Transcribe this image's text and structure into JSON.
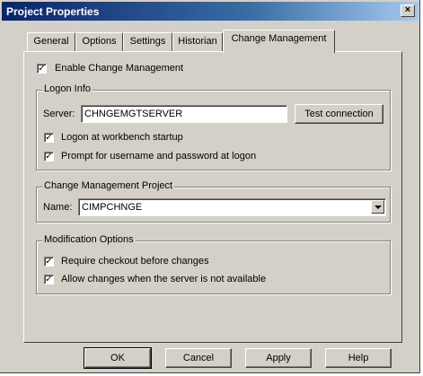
{
  "window": {
    "title": "Project Properties",
    "close_glyph": "×"
  },
  "tabs": [
    {
      "label": "General"
    },
    {
      "label": "Options"
    },
    {
      "label": "Settings"
    },
    {
      "label": "Historian"
    },
    {
      "label": "Change Management"
    }
  ],
  "enable": {
    "label": "Enable Change Management",
    "checked": true
  },
  "logon": {
    "title": "Logon Info",
    "server_label": "Server:",
    "server_value": "CHNGEMGTSERVER",
    "test_button": "Test connection",
    "startup_label": "Logon at workbench startup",
    "startup_checked": true,
    "prompt_label": "Prompt for username and password at logon",
    "prompt_checked": true
  },
  "project": {
    "title": "Change Management Project",
    "name_label": "Name:",
    "name_value": "CIMPCHNGE"
  },
  "modification": {
    "title": "Modification Options",
    "checkout_label": "Require checkout before changes",
    "checkout_checked": true,
    "allow_label": "Allow changes when the server is not available",
    "allow_checked": true
  },
  "check_glyph": "✓",
  "buttons": {
    "ok": "OK",
    "cancel": "Cancel",
    "apply": "Apply",
    "help": "Help"
  }
}
